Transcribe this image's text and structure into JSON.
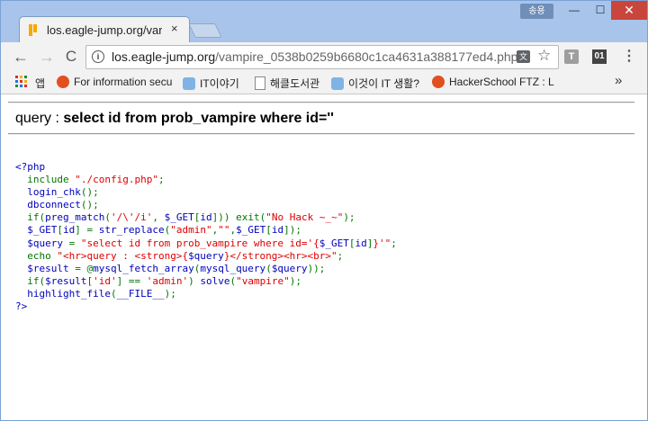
{
  "window": {
    "user_badge": "송용",
    "minimize": "—",
    "maximize": "☐",
    "close": "✕"
  },
  "tab": {
    "title": "los.eagle-jump.org/vampire",
    "close": "×"
  },
  "toolbar": {
    "back": "←",
    "forward": "→",
    "reload": "C",
    "info": "i",
    "url_host": "los.eagle-jump.org",
    "url_path": "/vampire_0538b0259b6680c1ca4631a388177ed4.php",
    "translate": "文",
    "star": "☆",
    "ext_t": "T",
    "ext_01": "01",
    "menu": "⋮"
  },
  "bookmarks": {
    "apps": "앱",
    "items": [
      "For information secu",
      "IT이야기",
      "해클도서관",
      "이것이 IT 생활?",
      "HackerSchool FTZ : L"
    ],
    "more": "»"
  },
  "page": {
    "query_label": "query : ",
    "query_sql": "select id from prob_vampire where id=''",
    "code": {
      "l1": "<?php",
      "l2a": "  include ",
      "l2b": "\"./config.php\"",
      "l2c": ";",
      "l3a": "  login_chk",
      "l3b": "();",
      "l4a": "  dbconnect",
      "l4b": "();",
      "l5a": "  if",
      "l5b": "(",
      "l5c": "preg_match",
      "l5d": "(",
      "l5e": "'/\\'/i'",
      "l5f": ", ",
      "l5g": "$_GET",
      "l5h": "[",
      "l5i": "id",
      "l5j": "])) ",
      "l5k": "exit",
      "l5l": "(",
      "l5m": "\"No Hack ~_~\"",
      "l5n": ");",
      "l6a": "  $_GET",
      "l6b": "[",
      "l6c": "id",
      "l6d": "] = ",
      "l6e": "str_replace",
      "l6f": "(",
      "l6g": "\"admin\"",
      "l6h": ",",
      "l6i": "\"\"",
      "l6j": ",",
      "l6k": "$_GET",
      "l6l": "[",
      "l6m": "id",
      "l6n": "]);",
      "l7a": "  $query ",
      "l7b": "= ",
      "l7c": "\"select id from prob_vampire where id='{",
      "l7d": "$_GET",
      "l7e": "[",
      "l7f": "id",
      "l7g": "]",
      "l7h": "}'\"",
      "l7i": ";",
      "l8a": "  echo ",
      "l8b": "\"<hr>query : <strong>{",
      "l8c": "$query",
      "l8d": "}</strong><hr><br>\"",
      "l8e": ";",
      "l9a": "  $result ",
      "l9b": "= @",
      "l9c": "mysql_fetch_array",
      "l9d": "(",
      "l9e": "mysql_query",
      "l9f": "(",
      "l9g": "$query",
      "l9h": "));",
      "l10a": "  if",
      "l10b": "(",
      "l10c": "$result",
      "l10d": "[",
      "l10e": "'id'",
      "l10f": "] == ",
      "l10g": "'admin'",
      "l10h": ") ",
      "l10i": "solve",
      "l10j": "(",
      "l10k": "\"vampire\"",
      "l10l": ");",
      "l11a": "  highlight_file",
      "l11b": "(",
      "l11c": "__FILE__",
      "l11d": ");",
      "l12": "?>"
    }
  }
}
